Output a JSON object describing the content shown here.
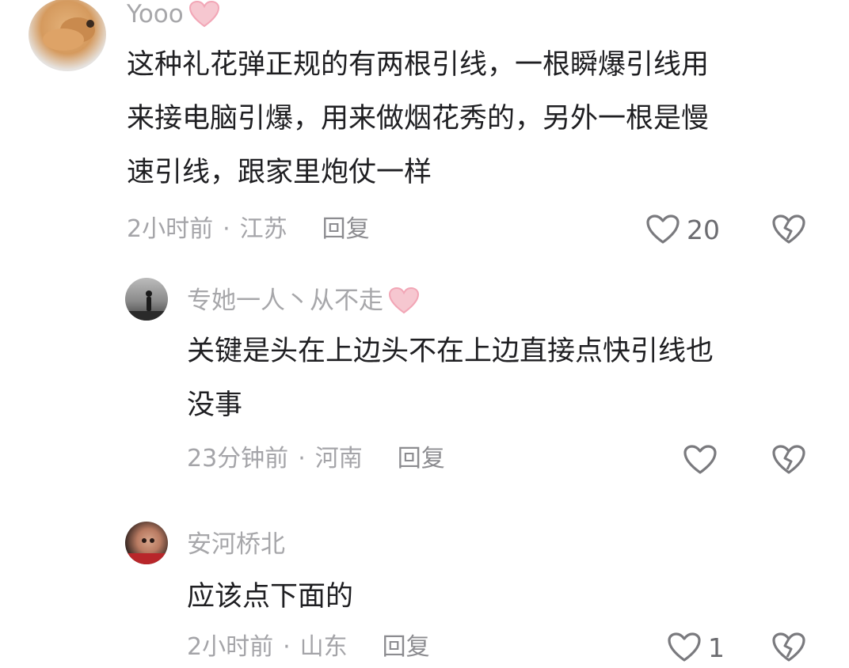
{
  "comments": [
    {
      "username": "Yooo",
      "username_emoji": "pink-heart-icon",
      "text_lines": [
        "这种礼花弹正规的有两根引线，一根瞬爆引线用",
        "来接电脑引爆，用来做烟花秀的，另外一根是慢",
        "速引线，跟家里炮仗一样"
      ],
      "time": "2小时前",
      "separator": "·",
      "location": "江苏",
      "reply_label": "回复",
      "like_count": "20"
    },
    {
      "username": "专她一人丶从不走",
      "username_emoji": "pink-heart-icon",
      "text_lines": [
        "关键是头在上边头不在上边直接点快引线也",
        "没事"
      ],
      "time": "23分钟前",
      "separator": "·",
      "location": "河南",
      "reply_label": "回复",
      "like_count": ""
    },
    {
      "username": "安河桥北",
      "username_emoji": "",
      "text_lines": [
        "应该点下面的"
      ],
      "time": "2小时前",
      "separator": "·",
      "location": "山东",
      "reply_label": "回复",
      "like_count": "1"
    }
  ],
  "colors": {
    "username": "#a7a7aa",
    "text": "#1f1f22",
    "meta": "#a4a4a8",
    "heart_emoji": "#f6b8c4",
    "icon_stroke": "#7a7a7e"
  }
}
